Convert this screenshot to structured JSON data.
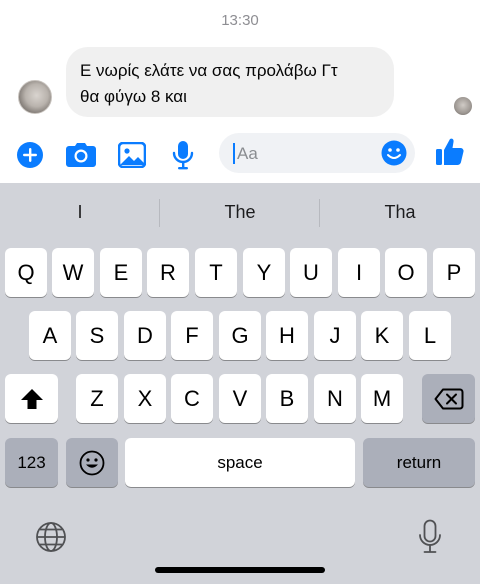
{
  "status": {
    "time": "13:30"
  },
  "chat": {
    "message_line1": "Ε νωρίς ελάτε να σας προλάβω Γτ",
    "message_line2": "θα φύγω 8 και"
  },
  "composer": {
    "placeholder": "Aa",
    "accent_color": "#0a7cff",
    "icons": [
      "plus-circle-icon",
      "camera-icon",
      "photo-icon",
      "microphone-icon",
      "emoji-icon",
      "thumbs-up-icon"
    ]
  },
  "keyboard": {
    "suggestions": [
      "I",
      "The",
      "Tha"
    ],
    "row1": [
      "Q",
      "W",
      "E",
      "R",
      "T",
      "Y",
      "U",
      "I",
      "O",
      "P"
    ],
    "row2": [
      "A",
      "S",
      "D",
      "F",
      "G",
      "H",
      "J",
      "K",
      "L"
    ],
    "row3": [
      "Z",
      "X",
      "C",
      "V",
      "B",
      "N",
      "M"
    ],
    "numbers_label": "123",
    "space_label": "space",
    "return_label": "return"
  }
}
